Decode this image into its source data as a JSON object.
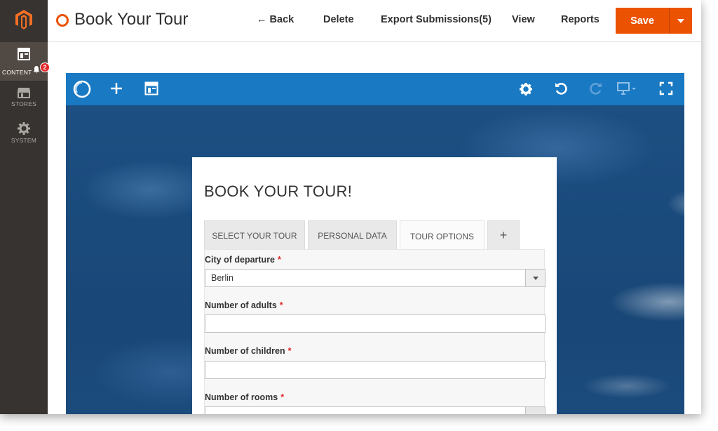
{
  "sidebar": {
    "items": [
      {
        "label": "CONTENT",
        "icon": "layout-icon",
        "active": true
      },
      {
        "label": "STORES",
        "icon": "store-icon",
        "active": false
      },
      {
        "label": "SYSTEM",
        "icon": "gear-icon",
        "active": false
      }
    ],
    "notification_count": "2"
  },
  "header": {
    "title": "Book Your Tour",
    "buttons": {
      "back": "← Back",
      "delete": "Delete",
      "export": "Export Submissions(5)",
      "view": "View",
      "reports": "Reports",
      "save": "Save"
    }
  },
  "colors": {
    "accent": "#eb5202",
    "builder_bar": "#1979c3",
    "sidebar": "#373330",
    "required": "#e02b27"
  },
  "form": {
    "title": "BOOK YOUR TOUR!",
    "tabs": [
      {
        "label": "SELECT YOUR TOUR",
        "active": false
      },
      {
        "label": "PERSONAL DATA",
        "active": false
      },
      {
        "label": "TOUR OPTIONS",
        "active": true
      },
      {
        "label": "+",
        "active": false
      }
    ],
    "fields": [
      {
        "label": "City of departure",
        "required": "*",
        "value": "Berlin",
        "type": "select"
      },
      {
        "label": "Number of adults",
        "required": "*",
        "value": "",
        "type": "text"
      },
      {
        "label": "Number of children",
        "required": "*",
        "value": "",
        "type": "text"
      },
      {
        "label": "Number of rooms",
        "required": "*",
        "value": "",
        "type": "select"
      }
    ]
  }
}
